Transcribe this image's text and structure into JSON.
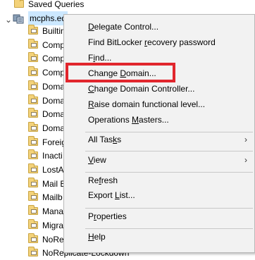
{
  "tree": {
    "saved_queries": "Saved Queries",
    "domain": "mcphs.ed",
    "items": [
      "Builtin",
      "Comp",
      "Comp",
      "Comp",
      "Doma",
      "Doma",
      "Doma",
      "Doma",
      "Foreig",
      "Inacti",
      "LostA",
      "Mail E",
      "Mailb",
      "Mana",
      "Migra",
      "NoRe",
      "NoReplicate-Lockdown"
    ]
  },
  "context_menu": {
    "delegate_control": [
      "",
      "D",
      "elegate Control..."
    ],
    "find_bitlocker": [
      "Find BitLocker ",
      "r",
      "ecovery password"
    ],
    "find": [
      "F",
      "i",
      "nd..."
    ],
    "change_domain": [
      "Change ",
      "D",
      "omain..."
    ],
    "change_dc": [
      "",
      "C",
      "hange Domain Controller..."
    ],
    "raise_level": [
      "",
      "R",
      "aise domain functional level..."
    ],
    "operations_masters": [
      "Operations ",
      "M",
      "asters..."
    ],
    "all_tasks": [
      "All Tas",
      "k",
      "s"
    ],
    "view": [
      "",
      "V",
      "iew"
    ],
    "refresh": [
      "Re",
      "f",
      "resh"
    ],
    "export_list": [
      "Export ",
      "L",
      "ist..."
    ],
    "properties": [
      "P",
      "r",
      "operties"
    ],
    "help": [
      "",
      "H",
      "elp"
    ]
  },
  "colors": {
    "highlight_border": "#e1262d"
  }
}
